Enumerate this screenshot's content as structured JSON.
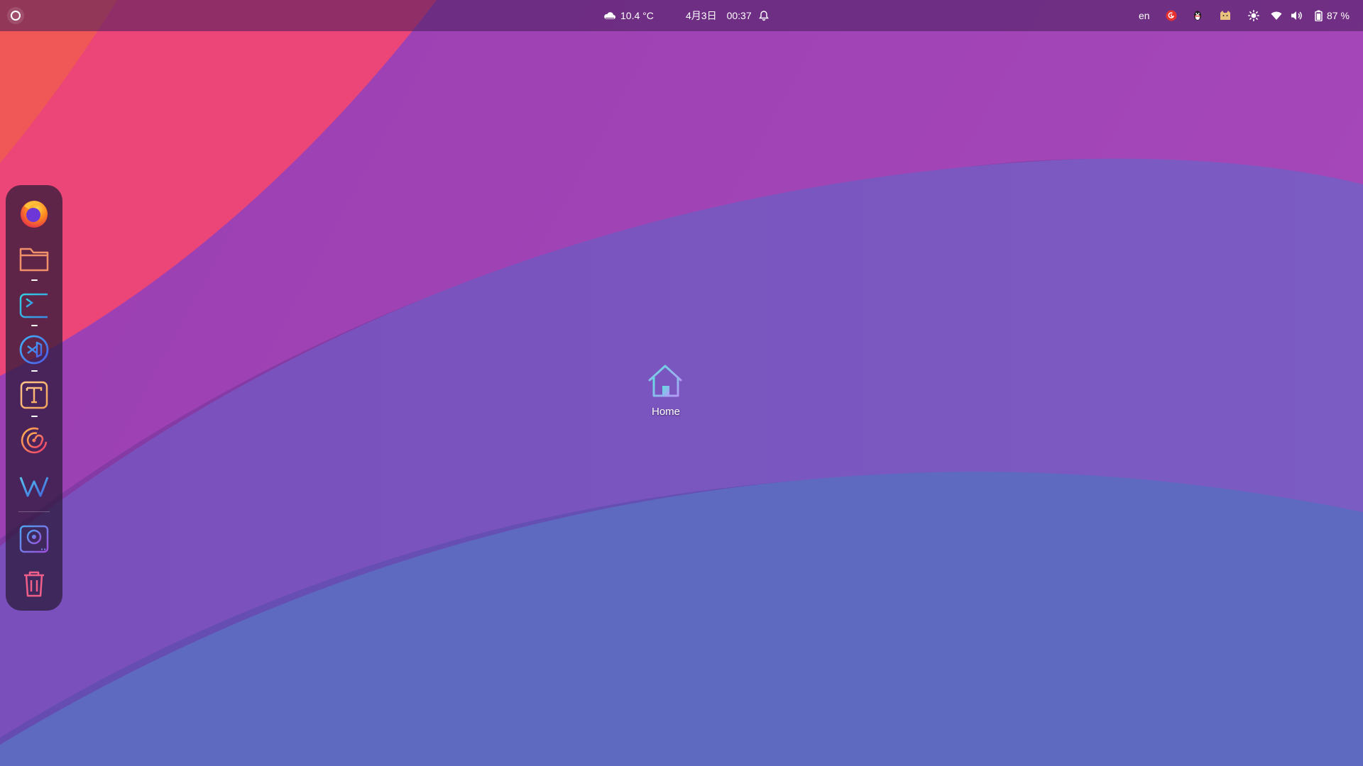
{
  "topbar": {
    "activities_icon": "activities-ring-icon",
    "weather": {
      "icon": "cloud-icon",
      "text": "10.4 °C"
    },
    "clock": {
      "date": "4月3日",
      "time": "00:37"
    },
    "notification_icon": "bell-icon",
    "tray": {
      "language": "en",
      "icons": [
        "netease-music-icon",
        "qq-penguin-icon",
        "cat-app-icon",
        "brightness-icon",
        "wifi-icon",
        "volume-icon"
      ],
      "battery_icon": "battery-icon",
      "battery_text": "87 %"
    }
  },
  "dock": {
    "items": [
      {
        "name": "Firefox",
        "icon": "firefox-icon",
        "running": false
      },
      {
        "name": "Files",
        "icon": "folder-icon",
        "running": true
      },
      {
        "name": "Terminal",
        "icon": "terminal-icon",
        "running": true
      },
      {
        "name": "Visual Studio Code",
        "icon": "vscode-icon",
        "running": true
      },
      {
        "name": "Text Editor",
        "icon": "text-editor-icon",
        "running": true
      },
      {
        "name": "NetEase Cloud Music",
        "icon": "music-icon",
        "running": false
      },
      {
        "name": "WPS Office",
        "icon": "wps-icon",
        "running": false
      },
      {
        "name": "Disks",
        "icon": "disk-icon",
        "running": false
      },
      {
        "name": "Trash",
        "icon": "trash-icon",
        "running": false
      }
    ]
  },
  "desktop": {
    "icons": [
      {
        "label": "Home",
        "icon": "home-folder-icon"
      }
    ]
  },
  "colors": {
    "wallpaper_coral": "#f25a5a",
    "wallpaper_pink": "#ec4478",
    "wallpaper_purple": "#a947b9",
    "wallpaper_violet": "#7b57bf",
    "wallpaper_blue": "#5e6ac0",
    "topbar_bg": "#6a2c76"
  }
}
